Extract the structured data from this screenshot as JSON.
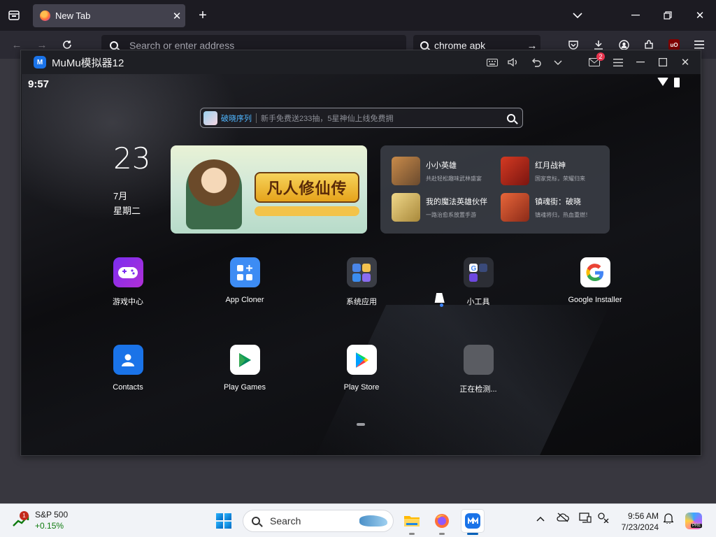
{
  "browser": {
    "tab_title": "New Tab",
    "url_placeholder": "Search or enter address",
    "search_value": "chrome apk"
  },
  "mumu": {
    "title": "MuMu模拟器12",
    "mail_badge": "2"
  },
  "android": {
    "time": "9:57",
    "search": {
      "tag": "破晓序列",
      "placeholder": "新手免费送233抽，5星神仙上线免费拥"
    },
    "date": {
      "day": "23",
      "month": "7月",
      "weekday": "星期二"
    },
    "banner": {
      "logo_text": "凡人修仙传"
    },
    "games": [
      {
        "name": "小小英雄",
        "desc": "共赴轻松趣味武林盛宴"
      },
      {
        "name": "红月战神",
        "desc": "国家竞标，荣耀归来"
      },
      {
        "name": "我的魔法英雄伙伴",
        "desc": "一路治愈系放置手游"
      },
      {
        "name": "镇魂街：破晓",
        "desc": "镇魂将归，热血重燃！"
      }
    ],
    "apps": [
      {
        "label": "游戏中心",
        "icon": "game-center-icon"
      },
      {
        "label": "App Cloner",
        "icon": "app-cloner-icon"
      },
      {
        "label": "系统应用",
        "icon": "system-apps-folder-icon"
      },
      {
        "label": "小工具",
        "icon": "tools-folder-icon"
      },
      {
        "label": "Google Installer",
        "icon": "google-icon"
      },
      {
        "label": "Contacts",
        "icon": "contacts-icon"
      },
      {
        "label": "Play Games",
        "icon": "play-games-icon"
      },
      {
        "label": "Play Store",
        "icon": "play-store-icon"
      },
      {
        "label": "正在检测...",
        "icon": "loading-app-icon"
      }
    ]
  },
  "taskbar": {
    "stock_name": "S&P 500",
    "stock_change": "+0.15%",
    "stock_badge": "1",
    "search_placeholder": "Search",
    "time": "9:56 AM",
    "date": "7/23/2024",
    "copilot_tag": "PRE"
  },
  "colors": {
    "firefox_tab": "#42414d",
    "mumu_accent": "#1a73e8",
    "stock_up": "#0f7b0f"
  }
}
